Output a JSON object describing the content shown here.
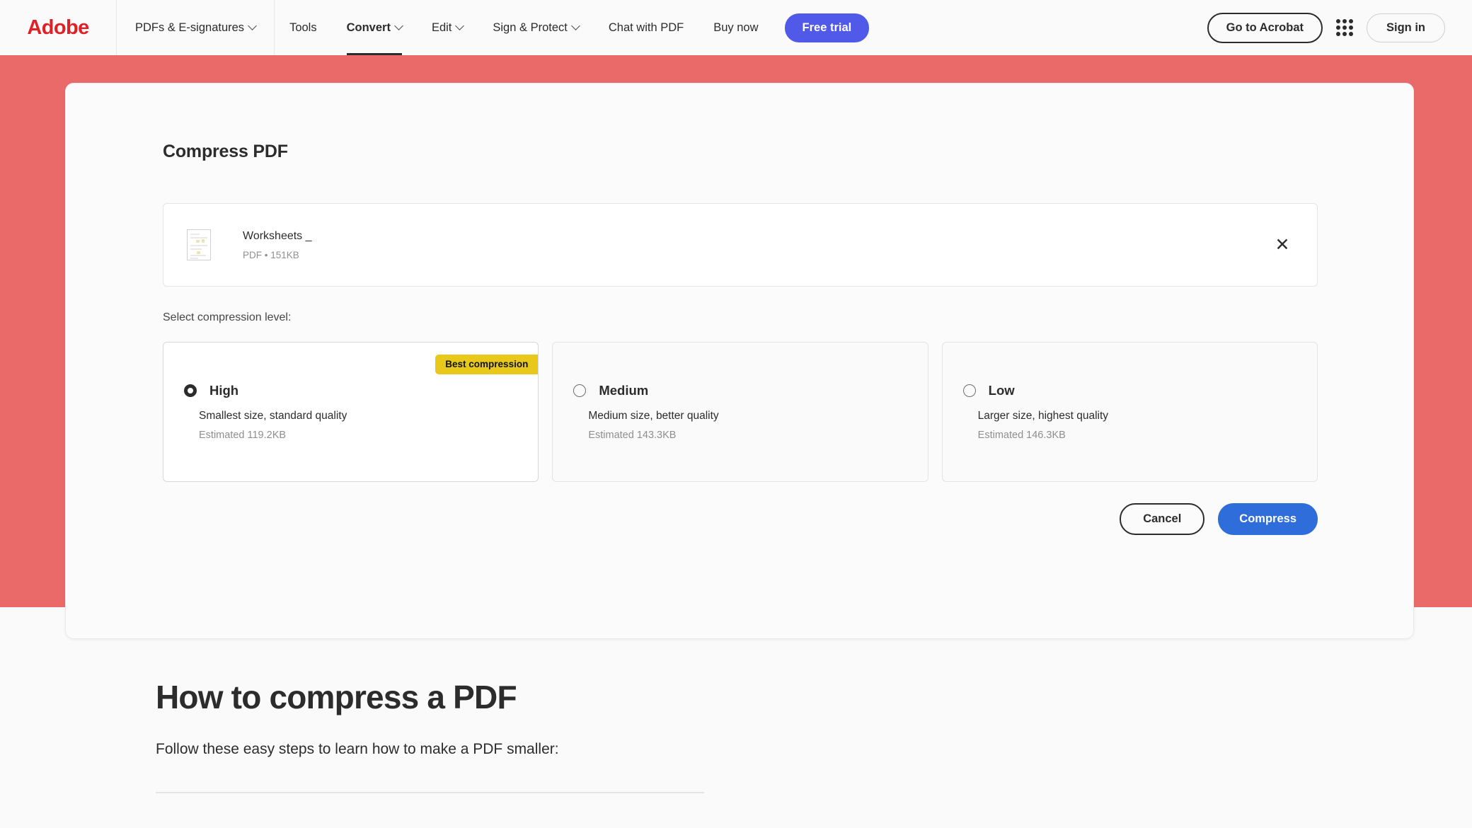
{
  "header": {
    "logo_text": "Adobe",
    "nav": [
      {
        "label": "PDFs & E-signatures",
        "has_chevron": true,
        "active": false
      },
      {
        "label": "Tools",
        "has_chevron": false,
        "active": false
      },
      {
        "label": "Convert",
        "has_chevron": true,
        "active": true
      },
      {
        "label": "Edit",
        "has_chevron": true,
        "active": false
      },
      {
        "label": "Sign & Protect",
        "has_chevron": true,
        "active": false
      },
      {
        "label": "Chat with PDF",
        "has_chevron": false,
        "active": false
      },
      {
        "label": "Buy now",
        "has_chevron": false,
        "active": false
      }
    ],
    "free_trial_label": "Free trial",
    "go_to_acrobat_label": "Go to Acrobat",
    "sign_in_label": "Sign in",
    "app_switcher_icon": "grid-dots-icon",
    "accent_free_trial": "#5159e8",
    "logo_color": "#e01f26"
  },
  "banner": {
    "background_color": "#ea6a6a"
  },
  "tool": {
    "title": "Compress PDF",
    "file": {
      "name": "Worksheets _",
      "meta": "PDF • 151KB",
      "thumbnail_icon": "pdf-page-thumbnail",
      "remove_icon": "close-icon"
    },
    "select_label": "Select compression level:",
    "options": [
      {
        "id": "high",
        "name": "High",
        "description": "Smallest size, standard quality",
        "estimate": "Estimated 119.2KB",
        "badge": "Best compression",
        "selected": true
      },
      {
        "id": "medium",
        "name": "Medium",
        "description": "Medium size, better quality",
        "estimate": "Estimated 143.3KB",
        "badge": "",
        "selected": false
      },
      {
        "id": "low",
        "name": "Low",
        "description": "Larger size, highest quality",
        "estimate": "Estimated 146.3KB",
        "badge": "",
        "selected": false
      }
    ],
    "badge_color": "#e8c81a",
    "cancel_label": "Cancel",
    "compress_label": "Compress",
    "compress_color": "#2f6ddb"
  },
  "howto": {
    "heading": "How to compress a PDF",
    "paragraph": "Follow these easy steps to learn how to make a PDF smaller:"
  }
}
